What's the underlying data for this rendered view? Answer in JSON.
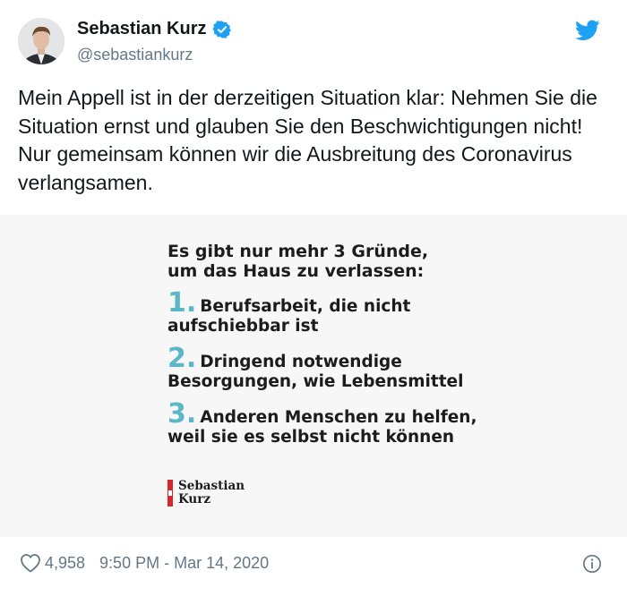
{
  "tweet": {
    "author_name": "Sebastian Kurz",
    "author_handle": "@sebastiankurz",
    "text": "Mein Appell ist in der derzeitigen Situation klar: Nehmen Sie die Situation ernst und glauben Sie den Beschwichtigungen nicht! Nur gemeinsam können wir die Ausbreitung des Coronavirus verlangsamen.",
    "likes": "4,958",
    "timestamp": "9:50 PM - Mar 14, 2020"
  },
  "image_card": {
    "headline_line1": "Es gibt nur mehr 3 Gründe,",
    "headline_line2": "um das Haus zu verlassen:",
    "reasons": [
      {
        "number": "1.",
        "line1": "Berufsarbeit, die nicht",
        "line2": "aufschiebbar ist"
      },
      {
        "number": "2.",
        "line1": "Dringend notwendige",
        "line2": "Besorgungen, wie Lebensmittel"
      },
      {
        "number": "3.",
        "line1": "Anderen Menschen zu helfen,",
        "line2": "weil sie es selbst nicht können"
      }
    ],
    "signature_line1": "Sebastian",
    "signature_line2": "Kurz"
  },
  "icons": {
    "verified": "verified-badge-icon",
    "brand": "twitter-bird-icon",
    "like": "heart-icon",
    "info": "info-icon"
  },
  "colors": {
    "verified_blue": "#1da1f2",
    "twitter_blue": "#1da1f2",
    "number_teal": "#5bb7c8",
    "meta_gray": "#657786",
    "signature_red": "#d8262d"
  }
}
